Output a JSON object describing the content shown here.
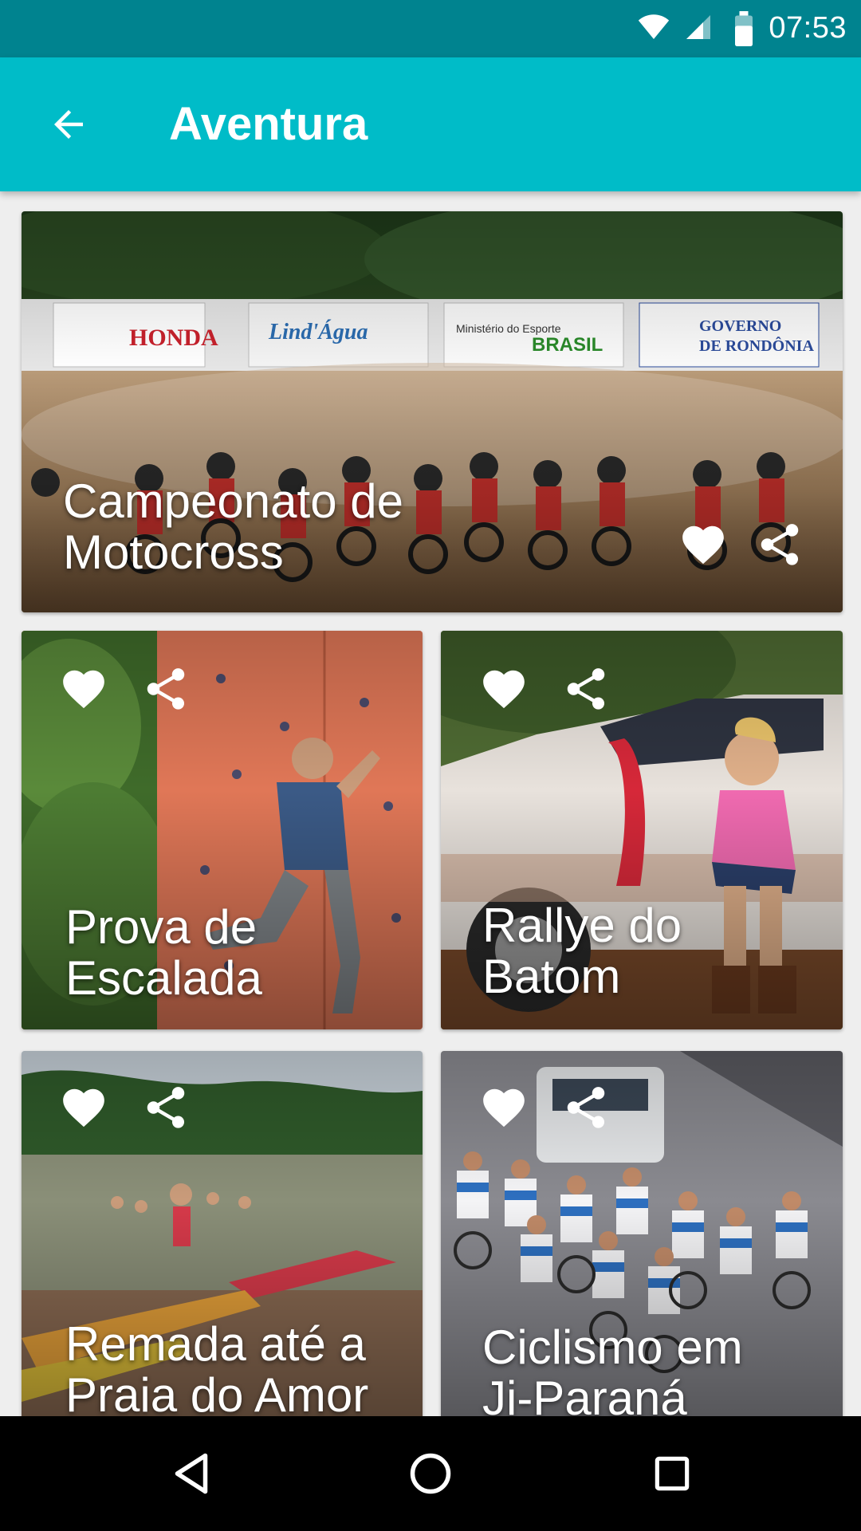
{
  "status_bar": {
    "time": "07:53",
    "icons": [
      "wifi-icon",
      "signal-icon",
      "battery-icon"
    ]
  },
  "app_bar": {
    "title": "Aventura",
    "back_icon": "arrow-back-icon"
  },
  "cards": [
    {
      "title": "Campeonato de Motocross",
      "line1": "Campeonato de",
      "line2": "Motocross",
      "favorite_icon": "heart-icon",
      "share_icon": "share-icon"
    },
    {
      "title": "Prova de Escalada",
      "line1": "Prova de",
      "line2": "Escalada",
      "favorite_icon": "heart-icon",
      "share_icon": "share-icon"
    },
    {
      "title": "Rallye do Batom",
      "line1": "Rallye do",
      "line2": "Batom",
      "favorite_icon": "heart-icon",
      "share_icon": "share-icon"
    },
    {
      "title": "Remada até a Praia do Amor",
      "line1": "Remada até a",
      "line2": "Praia do Amor",
      "favorite_icon": "heart-icon",
      "share_icon": "share-icon"
    },
    {
      "title": "Ciclismo em Ji-Paraná",
      "line1": "Ciclismo em",
      "line2": "Ji-Paraná",
      "favorite_icon": "heart-icon",
      "share_icon": "share-icon"
    }
  ],
  "banners": [
    "HONDA",
    "Lind'Água",
    "Ministério do Esporte",
    "BRASIL",
    "GOVERNO DE RONDÔNIA"
  ],
  "nav_bar": {
    "icons": [
      "back-triangle-icon",
      "home-circle-icon",
      "recents-square-icon"
    ]
  },
  "colors": {
    "status_bar": "#00838f",
    "app_bar": "#00bcc8",
    "nav_bar": "#000000"
  }
}
